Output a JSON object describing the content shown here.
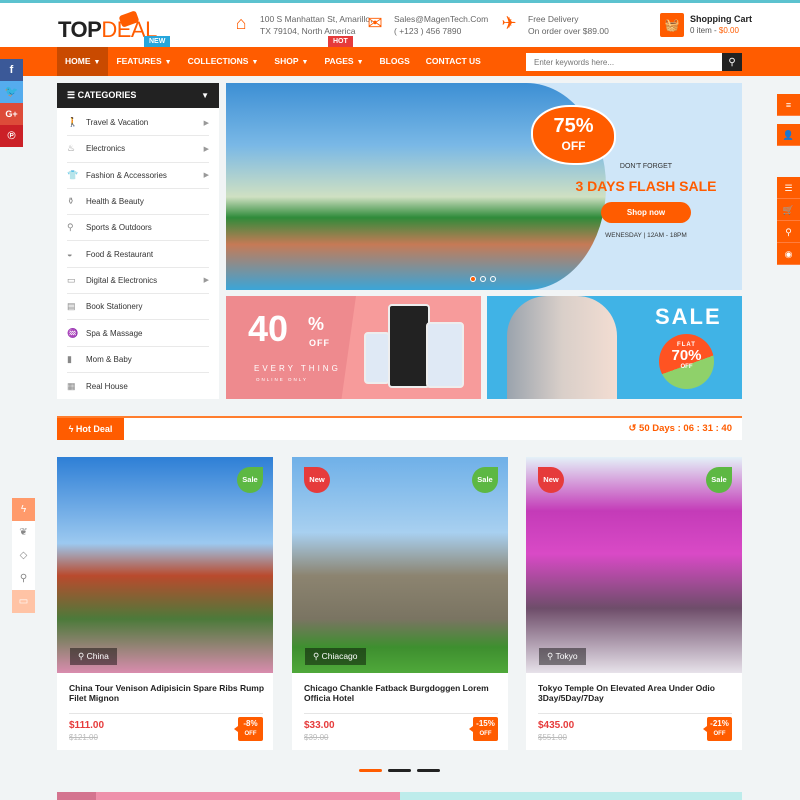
{
  "header": {
    "logo_top": "TOP",
    "logo_deal": "DEAL",
    "badges": {
      "new": "NEW",
      "hot": "HOT"
    },
    "address": {
      "line1": "100 S Manhattan St, Amarillo,",
      "line2": "TX 79104, North America",
      "icon": "home-icon"
    },
    "contact": {
      "line1": "Sales@MagenTech.Com",
      "line2": "( +123 ) 456 7890",
      "icon": "mail-icon"
    },
    "delivery": {
      "line1": "Free Delivery",
      "line2": "On order over $89.00",
      "icon": "plane-icon"
    },
    "cart": {
      "title": "Shopping Cart",
      "items": "0 item - ",
      "total": "$0.00",
      "icon": "basket-icon"
    }
  },
  "nav": {
    "items": [
      {
        "label": "HOME",
        "dropdown": true,
        "active": true
      },
      {
        "label": "FEATURES",
        "dropdown": true
      },
      {
        "label": "COLLECTIONS",
        "dropdown": true
      },
      {
        "label": "SHOP",
        "dropdown": true
      },
      {
        "label": "PAGES",
        "dropdown": true
      },
      {
        "label": "BLOGS",
        "dropdown": false
      },
      {
        "label": "CONTACT US",
        "dropdown": false
      }
    ],
    "search_placeholder": "Enter keywords here...",
    "search_value": ""
  },
  "social": [
    {
      "name": "facebook",
      "glyph": "f",
      "color": "#3b5998"
    },
    {
      "name": "twitter",
      "glyph": "t",
      "color": "#55acee"
    },
    {
      "name": "google-plus",
      "glyph": "G+",
      "color": "#dd4b39"
    },
    {
      "name": "pinterest",
      "glyph": "P",
      "color": "#cb2027"
    }
  ],
  "categories": {
    "title": "CATEGORIES",
    "items": [
      {
        "label": "Travel & Vacation",
        "sub": true
      },
      {
        "label": "Electronics",
        "sub": true
      },
      {
        "label": "Fashion & Accessories",
        "sub": true
      },
      {
        "label": "Health & Beauty",
        "sub": false
      },
      {
        "label": "Sports & Outdoors",
        "sub": false
      },
      {
        "label": "Food & Restaurant",
        "sub": false
      },
      {
        "label": "Digital & Electronics",
        "sub": true
      },
      {
        "label": "Book Stationery",
        "sub": false
      },
      {
        "label": "Spa & Massage",
        "sub": false
      },
      {
        "label": "Mom & Baby",
        "sub": false
      },
      {
        "label": "Real House",
        "sub": false
      }
    ]
  },
  "slider": {
    "badge_percent": "75%",
    "badge_off": "OFF",
    "kicker": "DON'T FORGET",
    "headline": "3 DAYS FLASH SALE",
    "button": "Shop now",
    "schedule": "WENESDAY | 12AM - 18PM",
    "active_dot": 0,
    "dot_count": 3
  },
  "banner1": {
    "big": "40",
    "pct": "%",
    "off": "OFF",
    "every": "EVERY THING",
    "online": "ONLINE ONLY"
  },
  "banner2": {
    "sale": "SALE",
    "flat": "FLAT",
    "value": "70%",
    "off": "OFF"
  },
  "hot_deal": {
    "label": "Hot Deal",
    "timer": "50 Days :  06 : 31 : 40"
  },
  "products": [
    {
      "location": "China",
      "tag": "Sale",
      "title": "China Tour Venison Adipisicin Spare Ribs Rump Filet Mignon",
      "price": "$111.00",
      "old_price": "$121.00",
      "discount": "-8%",
      "off": "OFF"
    },
    {
      "location": "Chiacago",
      "tag_left": "New",
      "tag": "Sale",
      "title": "Chicago Chankle Fatback Burgdoggen Lorem Officia Hotel",
      "price": "$33.00",
      "old_price": "$39.00",
      "discount": "-15%",
      "off": "OFF"
    },
    {
      "location": "Tokyo",
      "tag_left": "New",
      "tag": "Sale",
      "title": "Tokyo Temple On Elevated Area Under Odio 3Day/5Day/7Day",
      "price": "$435.00",
      "old_price": "$551.00",
      "discount": "-21%",
      "off": "OFF"
    }
  ],
  "carousel": {
    "active_page": 0,
    "page_count": 3
  },
  "colors": {
    "accent": "#ff5c00",
    "dark": "#222222",
    "price": "#e63b3b",
    "sale_tag": "#5db843",
    "new_tag": "#e63b3b"
  }
}
